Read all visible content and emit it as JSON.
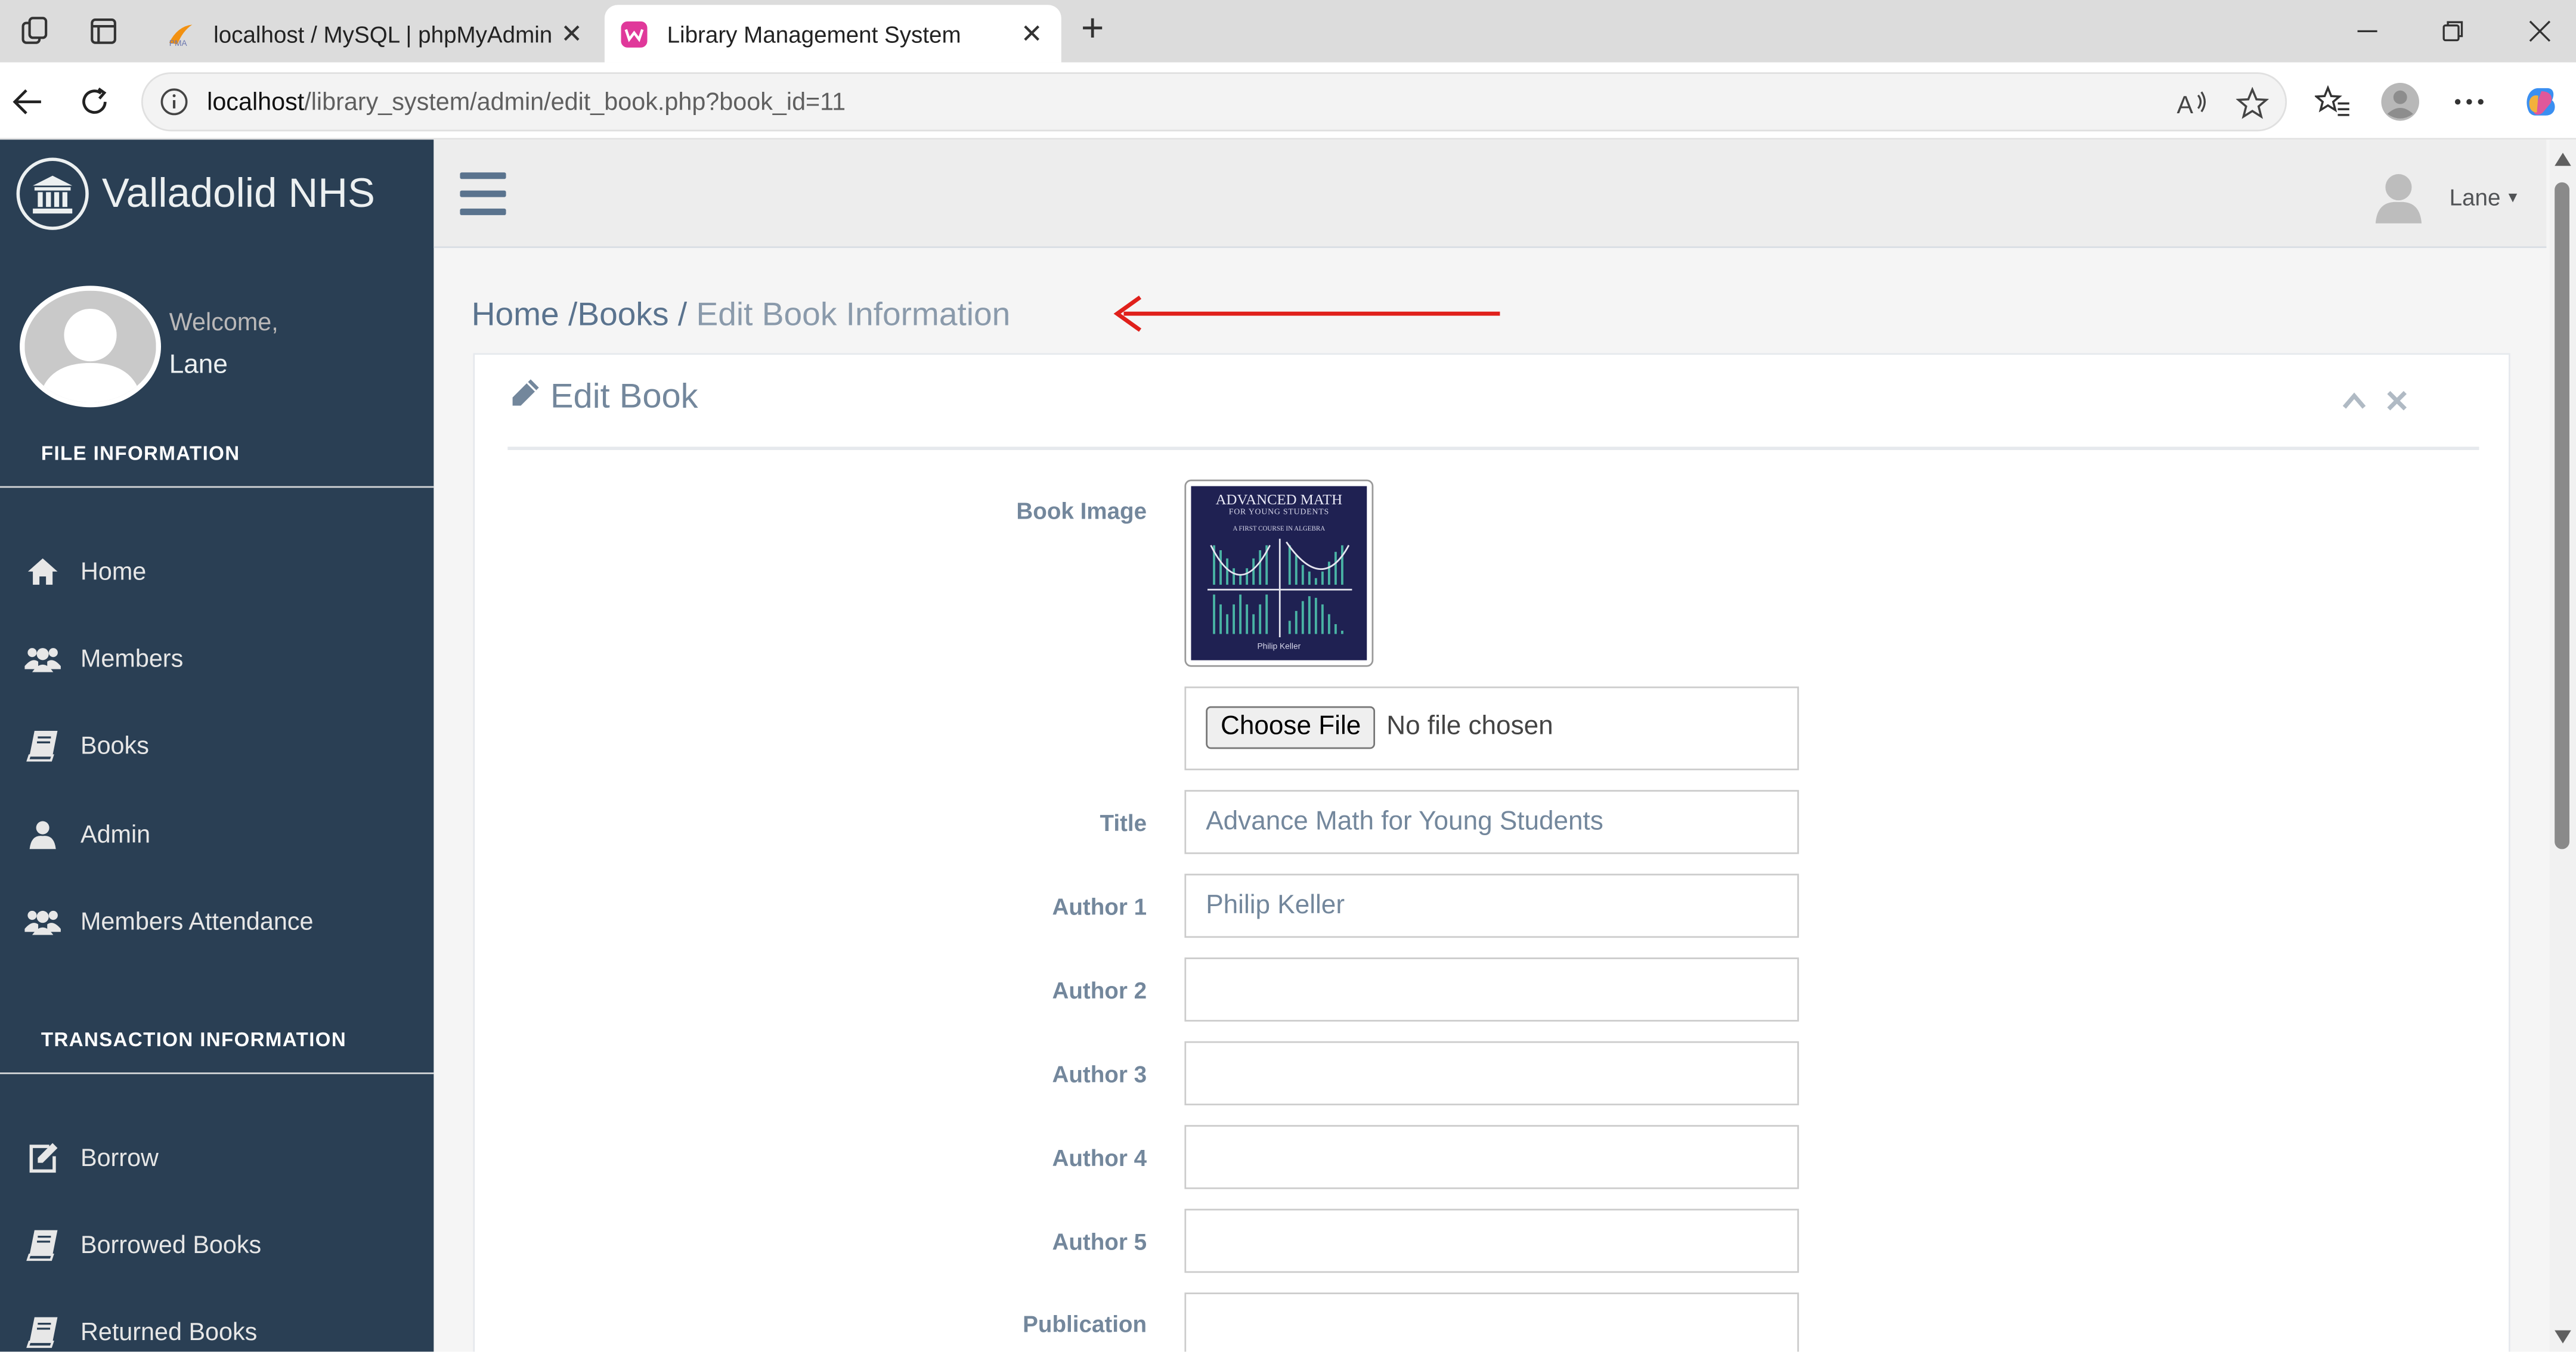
{
  "browser": {
    "tabs": [
      {
        "title": "localhost / MySQL | phpMyAdmin",
        "active": false
      },
      {
        "title": "Library Management System",
        "active": true
      }
    ],
    "url_host": "localhost",
    "url_path": "/library_system/admin/edit_book.php?book_id=11"
  },
  "sidebar": {
    "brand": "Valladolid NHS",
    "welcome": "Welcome,",
    "user_name": "Lane",
    "section1_title": "FILE INFORMATION",
    "menu1": [
      {
        "label": "Home",
        "icon": "home-icon"
      },
      {
        "label": "Members",
        "icon": "users-icon"
      },
      {
        "label": "Books",
        "icon": "book-icon"
      },
      {
        "label": "Admin",
        "icon": "user-icon"
      },
      {
        "label": "Members Attendance",
        "icon": "users-icon"
      }
    ],
    "section2_title": "TRANSACTION INFORMATION",
    "menu2": [
      {
        "label": "Borrow",
        "icon": "edit-icon"
      },
      {
        "label": "Borrowed Books",
        "icon": "book-icon"
      },
      {
        "label": "Returned Books",
        "icon": "book-icon"
      }
    ]
  },
  "topnav": {
    "user_name": "Lane"
  },
  "breadcrumb": {
    "home": "Home",
    "sep": "/",
    "books": "Books",
    "current": "Edit Book Information"
  },
  "panel": {
    "title": "Edit Book",
    "book_cover": {
      "title_line1": "ADVANCED MATH",
      "title_line2": "FOR YOUNG STUDENTS",
      "subtitle": "A FIRST COURSE IN ALGEBRA",
      "author": "Philip Keller"
    },
    "file_button": "Choose File",
    "file_status": "No file chosen",
    "fields": {
      "book_image_label": "Book Image",
      "title_label": "Title",
      "title_value": "Advance Math for Young Students",
      "author1_label": "Author 1",
      "author1_value": "Philip Keller",
      "author2_label": "Author 2",
      "author2_value": "",
      "author3_label": "Author 3",
      "author3_value": "",
      "author4_label": "Author 4",
      "author4_value": "",
      "author5_label": "Author 5",
      "author5_value": "",
      "publication_label": "Publication",
      "publication_value": ""
    }
  },
  "colors": {
    "sidebar_bg": "#2a3f54",
    "accent_text": "#73879c",
    "annotation_arrow": "#e0201b"
  }
}
